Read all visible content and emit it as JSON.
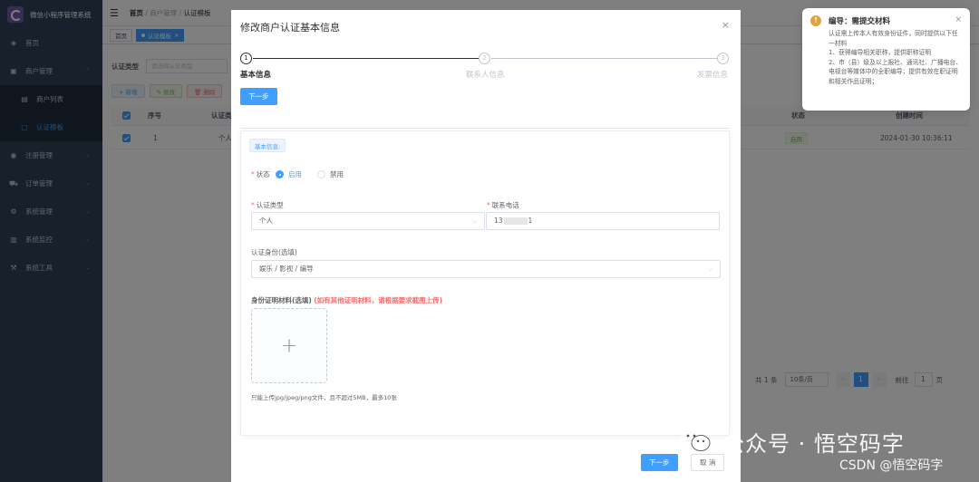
{
  "sidebar": {
    "app_title": "微信小程序管理系统",
    "items": [
      {
        "label": "首页",
        "icon": "dashboard-icon",
        "glyph": "◈"
      },
      {
        "label": "商户管理",
        "icon": "store-icon",
        "glyph": "▣"
      },
      {
        "label": "商户列表",
        "icon": "list-icon",
        "glyph": "▤"
      },
      {
        "label": "认证模板",
        "icon": "template-icon",
        "glyph": "▢"
      },
      {
        "label": "注册管理",
        "icon": "register-icon",
        "glyph": "◉"
      },
      {
        "label": "订单管理",
        "icon": "cart-icon",
        "glyph": "⛟"
      },
      {
        "label": "系统管理",
        "icon": "settings-icon",
        "glyph": "⚙"
      },
      {
        "label": "系统监控",
        "icon": "monitor-icon",
        "glyph": "▥"
      },
      {
        "label": "系统工具",
        "icon": "tools-icon",
        "glyph": "⚒"
      }
    ]
  },
  "header": {
    "breadcrumb": [
      "首页",
      "商户管理",
      "认证模板"
    ],
    "tabs": [
      "首页",
      "认证模板"
    ]
  },
  "page": {
    "filter_label": "认证类型",
    "filter_placeholder": "请选择认证类型",
    "buttons": [
      "+ 新增",
      "✎ 修改",
      "🗑 删除"
    ],
    "columns": [
      "序号",
      "认证类型",
      "状态",
      "创建时间"
    ],
    "rows": [
      {
        "index": "1",
        "type": "个人",
        "status": "启用",
        "created": "2024-01-30 10:36:11"
      }
    ],
    "pager": {
      "total": "共 1 条",
      "page_size": "10条/页",
      "prev": "‹",
      "current": "1",
      "next": "›",
      "goto_label": "前往",
      "goto_value": "1",
      "goto_suffix": "页"
    }
  },
  "dialog": {
    "title": "修改商户认证基本信息",
    "close": "×",
    "steps": [
      {
        "num": "1",
        "title": "基本信息",
        "active": true
      },
      {
        "num": "2",
        "title": "联系人信息",
        "active": false
      },
      {
        "num": "3",
        "title": "发票信息",
        "active": false
      }
    ],
    "next_top": "下一步",
    "section_tag": "基本信息:",
    "status_label": "状态",
    "status_options": [
      {
        "label": "启用",
        "checked": true
      },
      {
        "label": "禁用",
        "checked": false
      }
    ],
    "cert_type_label": "认证类型",
    "cert_type_value": "个人",
    "phone_label": "联系电话",
    "phone_prefix": "13",
    "phone_suffix": "1",
    "identity_label": "认证身份(选填)",
    "identity_value": "娱乐 / 影视 / 编导",
    "material_label": "身份证明材料(选填)",
    "material_note": "(如有其他证明材料，请根据要求截图上传)",
    "upload_plus": "+",
    "upload_hint": "只能上传jpg/jpeg/png文件，且不超过5MB，最多10张",
    "footer_next": "下一步",
    "footer_cancel": "取 消"
  },
  "notification": {
    "title": "编导：需提交材料",
    "close": "×",
    "body": "认证需上传本人有效身份证件，同时提供以下任一材料\n1、获得编导相关职称，提供职称证明\n2、市（县）级及以上报社、通讯社、广播电台、电视台等媒体中的全职编导；提供有效在职证明和相关作品证明；"
  },
  "watermark": {
    "line1": "公众号 · 悟空码字",
    "line2": "CSDN @悟空码字"
  }
}
